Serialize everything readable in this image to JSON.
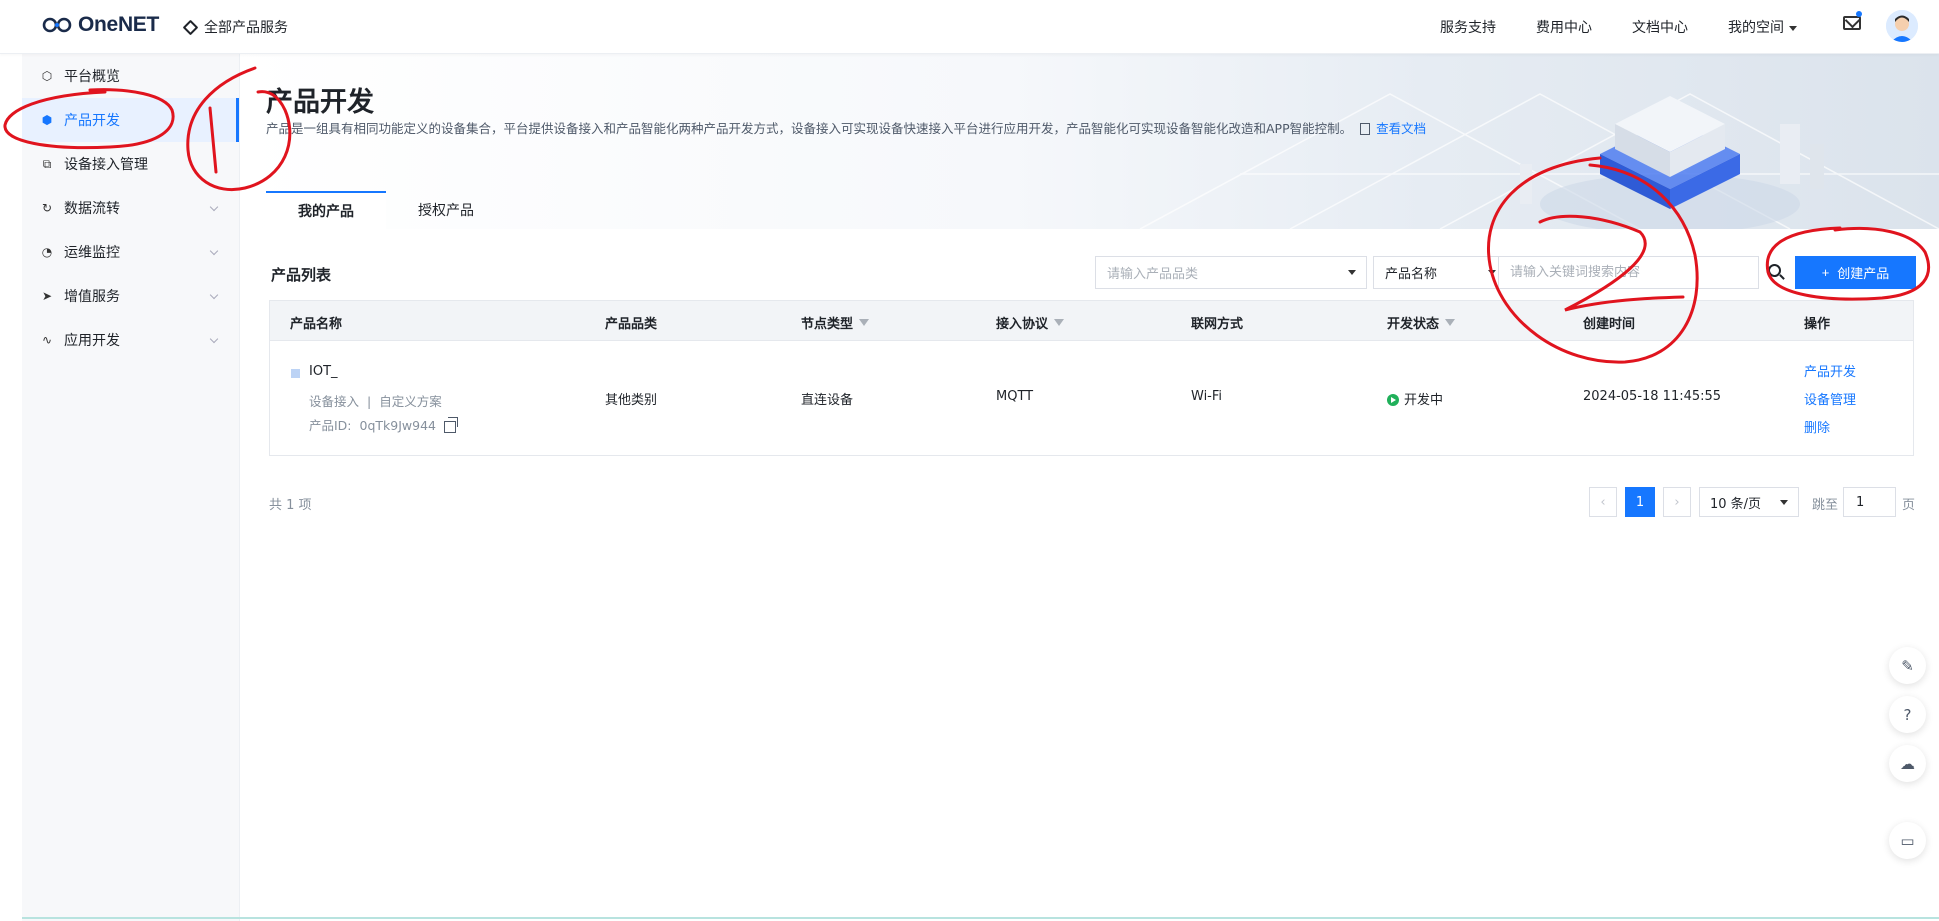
{
  "topbar": {
    "logo_text": "OneNET",
    "all_services": "全部产品服务",
    "nav": [
      "服务支持",
      "费用中心",
      "文档中心"
    ],
    "my_space": "我的空间"
  },
  "sidebar": {
    "items": [
      {
        "label": "平台概览",
        "icon": "overview-icon"
      },
      {
        "label": "产品开发",
        "icon": "cube-icon"
      },
      {
        "label": "设备接入管理",
        "icon": "device-icon"
      },
      {
        "label": "数据流转",
        "icon": "flow-icon"
      },
      {
        "label": "运维监控",
        "icon": "monitor-icon"
      },
      {
        "label": "增值服务",
        "icon": "send-icon"
      },
      {
        "label": "应用开发",
        "icon": "app-icon"
      }
    ]
  },
  "hero": {
    "title": "产品开发",
    "description": "产品是一组具有相同功能定义的设备集合，平台提供设备接入和产品智能化两种产品开发方式，设备接入可实现设备快速接入平台进行应用开发，产品智能化可实现设备智能化改造和APP智能控制。",
    "doc_link": "查看文档",
    "tabs": [
      "我的产品",
      "授权产品"
    ]
  },
  "list": {
    "title": "产品列表",
    "category_placeholder": "请输入产品品类",
    "search_field": "产品名称",
    "search_placeholder": "请输入关键词搜索内容",
    "create_label": "创建产品"
  },
  "table": {
    "headers": {
      "name": "产品名称",
      "category": "产品品类",
      "node": "节点类型",
      "protocol": "接入协议",
      "network": "联网方式",
      "status": "开发状态",
      "created": "创建时间",
      "actions": "操作"
    },
    "rows": [
      {
        "name": "IOT_",
        "access": "设备接入",
        "scheme": "自定义方案",
        "id_label": "产品ID:",
        "id": "0qTk9Jw944",
        "category": "其他类别",
        "node": "直连设备",
        "protocol": "MQTT",
        "network": "Wi-Fi",
        "status": "开发中",
        "created": "2024-05-18 11:45:55",
        "actions": [
          "产品开发",
          "设备管理",
          "删除"
        ]
      }
    ]
  },
  "pagination": {
    "total": "共 1 项",
    "current_page": "1",
    "page_size": "10 条/页",
    "jump_label": "跳至",
    "jump_value": "1",
    "page_unit": "页"
  },
  "annotations": {
    "color": "#e0141e",
    "marks": [
      "1",
      "2"
    ]
  },
  "colors": {
    "accent": "#1677ff",
    "status_green": "#20b05a"
  }
}
